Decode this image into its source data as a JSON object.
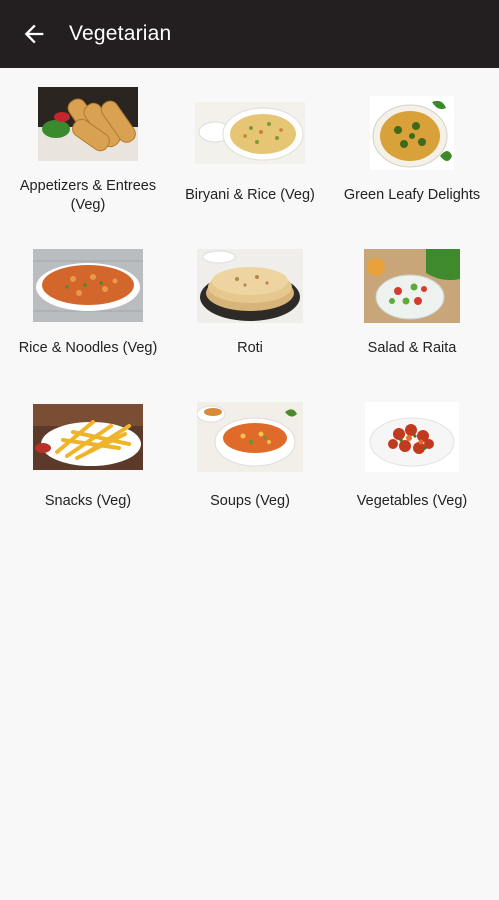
{
  "app_bar": {
    "title": "Vegetarian",
    "back_icon": "arrow-left-icon",
    "background": "#231f20"
  },
  "categories": [
    {
      "label": "Appetizers & Entrees (Veg)",
      "image": "spring-rolls-image"
    },
    {
      "label": "Biryani & Rice (Veg)",
      "image": "biryani-image"
    },
    {
      "label": "Green Leafy Delights",
      "image": "leafy-curry-image"
    },
    {
      "label": "Rice & Noodles (Veg)",
      "image": "noodles-image"
    },
    {
      "label": "Roti",
      "image": "roti-image"
    },
    {
      "label": "Salad & Raita",
      "image": "salad-image"
    },
    {
      "label": "Snacks (Veg)",
      "image": "fries-image"
    },
    {
      "label": "Soups (Veg)",
      "image": "soup-image"
    },
    {
      "label": "Vegetables (Veg)",
      "image": "vegetables-image"
    }
  ]
}
